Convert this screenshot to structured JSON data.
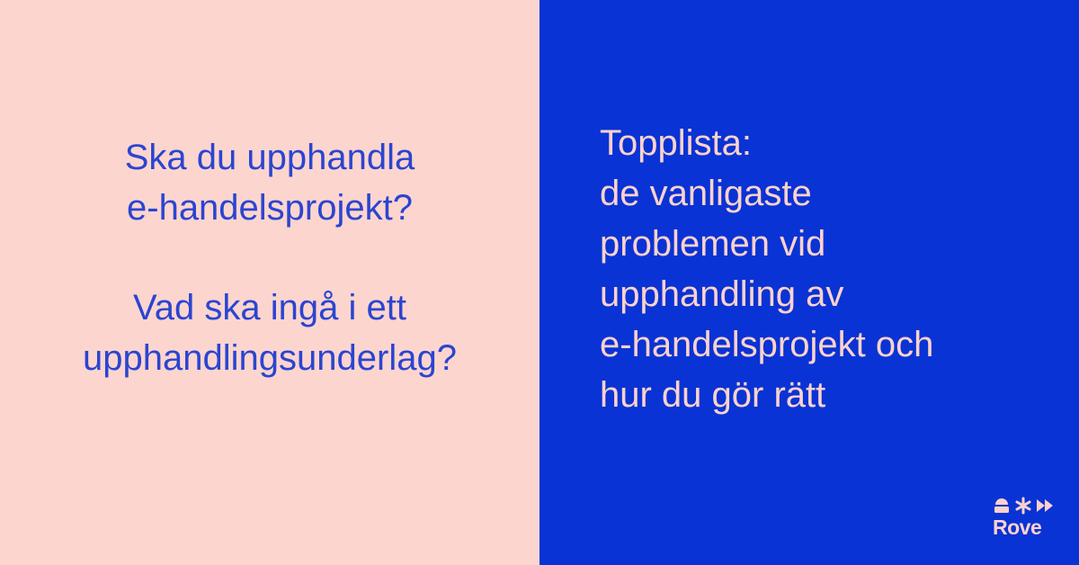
{
  "left": {
    "question_1": [
      "Ska du upphandla",
      "e-handelsprojekt?"
    ],
    "question_2": [
      "Vad ska ingå i ett",
      "upphandlingsunderlag?"
    ]
  },
  "right": {
    "lines": [
      "Topplista:",
      "de vanligaste",
      "problemen vid",
      "upphandling av",
      "e-handelsprojekt och",
      "hur du gör rätt"
    ]
  },
  "logo": {
    "wordmark": "Rove",
    "icons": [
      "person-icon",
      "asterisk-icon",
      "fast-forward-icon"
    ]
  },
  "colors": {
    "left_background": "#fdd5cf",
    "left_text": "#2a45d0",
    "right_background": "#0933d4",
    "right_text": "#fdd2cc"
  }
}
